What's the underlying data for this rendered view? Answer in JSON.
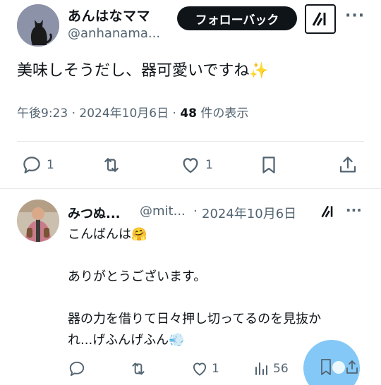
{
  "post": {
    "display_name": "あんはなママ",
    "handle": "@anhanama...",
    "follow_label": "フォローバック",
    "text": "美味しそうだし、器可愛いですね✨",
    "time": "午後9:23",
    "date": "2024年10月6日",
    "views_count": "48",
    "views_label": "件の表示",
    "actions": {
      "reply_count": "1",
      "retweet_count": "",
      "like_count": "1"
    },
    "icons": [
      "grok-icon",
      "more-icon",
      "reply-icon",
      "retweet-icon",
      "like-icon",
      "bookmark-icon",
      "share-icon"
    ]
  },
  "reply": {
    "display_name": "みつぬ...",
    "handle": "@mit...",
    "date": "2024年10月6日",
    "lines": [
      "こんばんは🤗",
      "ありがとうございます。",
      "器の力を借りて日々押し切ってるのを見抜か",
      "れ...げふんげふん💨"
    ],
    "actions": {
      "like_count": "1",
      "views_count": "56"
    }
  },
  "colors": {
    "text": "#0f1419",
    "secondary": "#536471",
    "divider": "#e7e9ea",
    "fab": "#1d9bf0"
  }
}
